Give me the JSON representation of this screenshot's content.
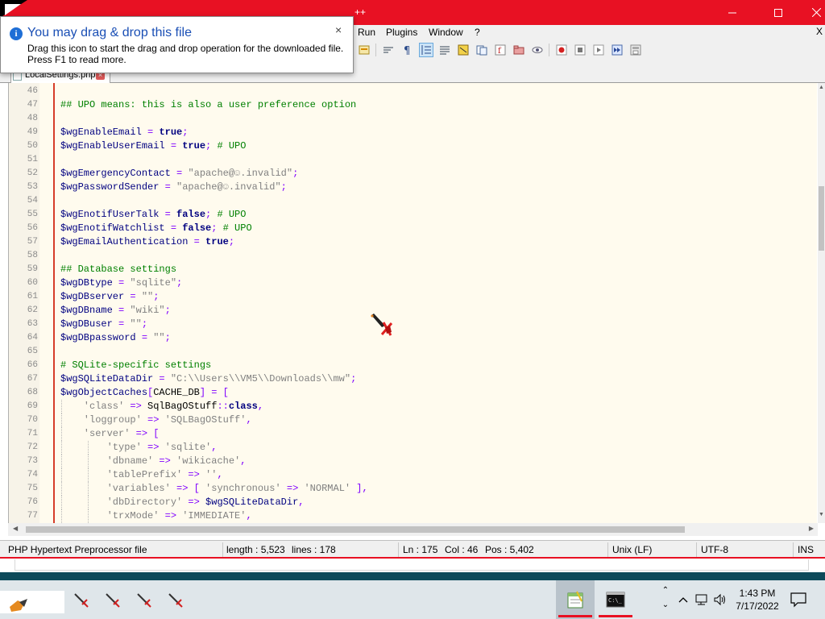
{
  "window": {
    "title": "Notepad++",
    "title_visible": "++",
    "controls": {
      "minimize": "minimize",
      "maximize": "maximize",
      "close": "close"
    }
  },
  "menu": {
    "items": [
      "Run",
      "Plugins",
      "Window",
      "?"
    ],
    "close_label": "X"
  },
  "tab": {
    "label": "LocalSettings.php"
  },
  "editor": {
    "lines": [
      {
        "n": "46",
        "tokens": []
      },
      {
        "n": "47",
        "tokens": [
          {
            "t": "## UPO means: this is also a user preference option",
            "c": "c-cmt"
          }
        ]
      },
      {
        "n": "48",
        "tokens": []
      },
      {
        "n": "49",
        "tokens": [
          {
            "t": "$wgEnableEmail",
            "c": "c-var"
          },
          {
            "t": " = ",
            "c": "c-op"
          },
          {
            "t": "true",
            "c": "c-kw"
          },
          {
            "t": ";",
            "c": "c-op"
          }
        ]
      },
      {
        "n": "50",
        "tokens": [
          {
            "t": "$wgEnableUserEmail",
            "c": "c-var"
          },
          {
            "t": " = ",
            "c": "c-op"
          },
          {
            "t": "true",
            "c": "c-kw"
          },
          {
            "t": "; ",
            "c": "c-op"
          },
          {
            "t": "# UPO",
            "c": "c-cmt"
          }
        ]
      },
      {
        "n": "51",
        "tokens": []
      },
      {
        "n": "52",
        "tokens": [
          {
            "t": "$wgEmergencyContact",
            "c": "c-var"
          },
          {
            "t": " = ",
            "c": "c-op"
          },
          {
            "t": "\"apache@",
            "c": "c-str"
          },
          {
            "t": "☺",
            "c": "c-str"
          },
          {
            "t": ".invalid\"",
            "c": "c-str"
          },
          {
            "t": ";",
            "c": "c-op"
          }
        ]
      },
      {
        "n": "53",
        "tokens": [
          {
            "t": "$wgPasswordSender",
            "c": "c-var"
          },
          {
            "t": " = ",
            "c": "c-op"
          },
          {
            "t": "\"apache@",
            "c": "c-str"
          },
          {
            "t": "☺",
            "c": "c-str"
          },
          {
            "t": ".invalid\"",
            "c": "c-str"
          },
          {
            "t": ";",
            "c": "c-op"
          }
        ]
      },
      {
        "n": "54",
        "tokens": []
      },
      {
        "n": "55",
        "tokens": [
          {
            "t": "$wgEnotifUserTalk",
            "c": "c-var"
          },
          {
            "t": " = ",
            "c": "c-op"
          },
          {
            "t": "false",
            "c": "c-kw"
          },
          {
            "t": "; ",
            "c": "c-op"
          },
          {
            "t": "# UPO",
            "c": "c-cmt"
          }
        ]
      },
      {
        "n": "56",
        "tokens": [
          {
            "t": "$wgEnotifWatchlist",
            "c": "c-var"
          },
          {
            "t": " = ",
            "c": "c-op"
          },
          {
            "t": "false",
            "c": "c-kw"
          },
          {
            "t": "; ",
            "c": "c-op"
          },
          {
            "t": "# UPO",
            "c": "c-cmt"
          }
        ]
      },
      {
        "n": "57",
        "tokens": [
          {
            "t": "$wgEmailAuthentication",
            "c": "c-var"
          },
          {
            "t": " = ",
            "c": "c-op"
          },
          {
            "t": "true",
            "c": "c-kw"
          },
          {
            "t": ";",
            "c": "c-op"
          }
        ]
      },
      {
        "n": "58",
        "tokens": []
      },
      {
        "n": "59",
        "tokens": [
          {
            "t": "## Database settings",
            "c": "c-cmt"
          }
        ]
      },
      {
        "n": "60",
        "tokens": [
          {
            "t": "$wgDBtype",
            "c": "c-var"
          },
          {
            "t": " = ",
            "c": "c-op"
          },
          {
            "t": "\"sqlite\"",
            "c": "c-str"
          },
          {
            "t": ";",
            "c": "c-op"
          }
        ]
      },
      {
        "n": "61",
        "tokens": [
          {
            "t": "$wgDBserver",
            "c": "c-var"
          },
          {
            "t": " = ",
            "c": "c-op"
          },
          {
            "t": "\"\"",
            "c": "c-str"
          },
          {
            "t": ";",
            "c": "c-op"
          }
        ]
      },
      {
        "n": "62",
        "tokens": [
          {
            "t": "$wgDBname",
            "c": "c-var"
          },
          {
            "t": " = ",
            "c": "c-op"
          },
          {
            "t": "\"wiki\"",
            "c": "c-str"
          },
          {
            "t": ";",
            "c": "c-op"
          }
        ]
      },
      {
        "n": "63",
        "tokens": [
          {
            "t": "$wgDBuser",
            "c": "c-var"
          },
          {
            "t": " = ",
            "c": "c-op"
          },
          {
            "t": "\"\"",
            "c": "c-str"
          },
          {
            "t": ";",
            "c": "c-op"
          }
        ]
      },
      {
        "n": "64",
        "tokens": [
          {
            "t": "$wgDBpassword",
            "c": "c-var"
          },
          {
            "t": " = ",
            "c": "c-op"
          },
          {
            "t": "\"\"",
            "c": "c-str"
          },
          {
            "t": ";",
            "c": "c-op"
          }
        ]
      },
      {
        "n": "65",
        "tokens": []
      },
      {
        "n": "66",
        "tokens": [
          {
            "t": "# SQLite-specific settings",
            "c": "c-cmt"
          }
        ]
      },
      {
        "n": "67",
        "tokens": [
          {
            "t": "$wgSQLiteDataDir",
            "c": "c-var"
          },
          {
            "t": " = ",
            "c": "c-op"
          },
          {
            "t": "\"C:\\\\Users\\\\VM5\\\\Downloads\\\\mw\"",
            "c": "c-str"
          },
          {
            "t": ";",
            "c": "c-op"
          }
        ]
      },
      {
        "n": "68",
        "tokens": [
          {
            "t": "$wgObjectCaches",
            "c": "c-var"
          },
          {
            "t": "[",
            "c": "c-op"
          },
          {
            "t": "CACHE_DB",
            "c": "c-cls"
          },
          {
            "t": "] = [",
            "c": "c-op"
          }
        ]
      },
      {
        "n": "69",
        "ind": 1,
        "tokens": [
          {
            "t": "    'class'",
            "c": "c-str"
          },
          {
            "t": " => ",
            "c": "c-op"
          },
          {
            "t": "SqlBagOStuff",
            "c": "c-cls"
          },
          {
            "t": "::",
            "c": "c-op"
          },
          {
            "t": "class",
            "c": "c-kw"
          },
          {
            "t": ",",
            "c": "c-op"
          }
        ]
      },
      {
        "n": "70",
        "ind": 1,
        "tokens": [
          {
            "t": "    'loggroup'",
            "c": "c-str"
          },
          {
            "t": " => ",
            "c": "c-op"
          },
          {
            "t": "'SQLBagOStuff'",
            "c": "c-str"
          },
          {
            "t": ",",
            "c": "c-op"
          }
        ]
      },
      {
        "n": "71",
        "ind": 1,
        "tokens": [
          {
            "t": "    'server'",
            "c": "c-str"
          },
          {
            "t": " => [",
            "c": "c-op"
          }
        ]
      },
      {
        "n": "72",
        "ind": 2,
        "tokens": [
          {
            "t": "        'type'",
            "c": "c-str"
          },
          {
            "t": " => ",
            "c": "c-op"
          },
          {
            "t": "'sqlite'",
            "c": "c-str"
          },
          {
            "t": ",",
            "c": "c-op"
          }
        ]
      },
      {
        "n": "73",
        "ind": 2,
        "tokens": [
          {
            "t": "        'dbname'",
            "c": "c-str"
          },
          {
            "t": " => ",
            "c": "c-op"
          },
          {
            "t": "'wikicache'",
            "c": "c-str"
          },
          {
            "t": ",",
            "c": "c-op"
          }
        ]
      },
      {
        "n": "74",
        "ind": 2,
        "tokens": [
          {
            "t": "        'tablePrefix'",
            "c": "c-str"
          },
          {
            "t": " => ",
            "c": "c-op"
          },
          {
            "t": "''",
            "c": "c-str"
          },
          {
            "t": ",",
            "c": "c-op"
          }
        ]
      },
      {
        "n": "75",
        "ind": 2,
        "tokens": [
          {
            "t": "        'variables'",
            "c": "c-str"
          },
          {
            "t": " => [ ",
            "c": "c-op"
          },
          {
            "t": "'synchronous'",
            "c": "c-str"
          },
          {
            "t": " => ",
            "c": "c-op"
          },
          {
            "t": "'NORMAL'",
            "c": "c-str"
          },
          {
            "t": " ],",
            "c": "c-op"
          }
        ]
      },
      {
        "n": "76",
        "ind": 2,
        "tokens": [
          {
            "t": "        'dbDirectory'",
            "c": "c-str"
          },
          {
            "t": " => ",
            "c": "c-op"
          },
          {
            "t": "$wgSQLiteDataDir",
            "c": "c-var"
          },
          {
            "t": ",",
            "c": "c-op"
          }
        ]
      },
      {
        "n": "77",
        "ind": 2,
        "tokens": [
          {
            "t": "        'trxMode'",
            "c": "c-str"
          },
          {
            "t": " => ",
            "c": "c-op"
          },
          {
            "t": "'IMMEDIATE'",
            "c": "c-str"
          },
          {
            "t": ",",
            "c": "c-op"
          }
        ]
      }
    ]
  },
  "status": {
    "file_type": "PHP Hypertext Preprocessor file",
    "length": "length : 5,523",
    "lines": "lines : 178",
    "ln": "Ln : 175",
    "col": "Col : 46",
    "pos": "Pos : 5,402",
    "eol": "Unix (LF)",
    "encoding": "UTF-8",
    "mode": "INS"
  },
  "toast": {
    "title": "You may drag & drop this file",
    "message_1": "Drag this icon to start the drag and drop operation for the downloaded file.",
    "message_2": "Press F1 to read more.",
    "close": "×"
  },
  "taskbar": {
    "time": "1:43 PM",
    "date": "7/17/2022"
  },
  "colors": {
    "titlebar": "#e81123",
    "editor_bg": "#fffbee",
    "comment": "#008000",
    "keyword": "#000080",
    "string": "#808080",
    "operator": "#8000ff"
  }
}
